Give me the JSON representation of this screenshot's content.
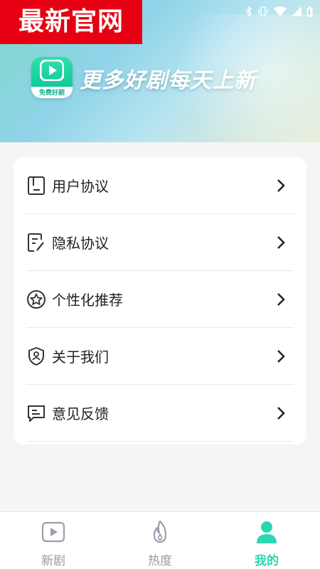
{
  "watermark": "最新官网",
  "logo": {
    "text": "免费好剧"
  },
  "banner": {
    "slogan": "更多好剧每天上新"
  },
  "menu": [
    {
      "label": "用户协议",
      "icon": "book-icon"
    },
    {
      "label": "隐私协议",
      "icon": "document-edit-icon"
    },
    {
      "label": "个性化推荐",
      "icon": "star-circle-icon"
    },
    {
      "label": "关于我们",
      "icon": "shield-user-icon"
    },
    {
      "label": "意见反馈",
      "icon": "message-icon"
    }
  ],
  "nav": [
    {
      "label": "新剧",
      "icon": "play-icon",
      "active": false
    },
    {
      "label": "热度",
      "icon": "flame-icon",
      "active": false
    },
    {
      "label": "我的",
      "icon": "user-icon",
      "active": true
    }
  ],
  "colors": {
    "accent": "#2cd6b0",
    "watermark_bg": "#e60012",
    "inactive": "#9a9a9a"
  }
}
